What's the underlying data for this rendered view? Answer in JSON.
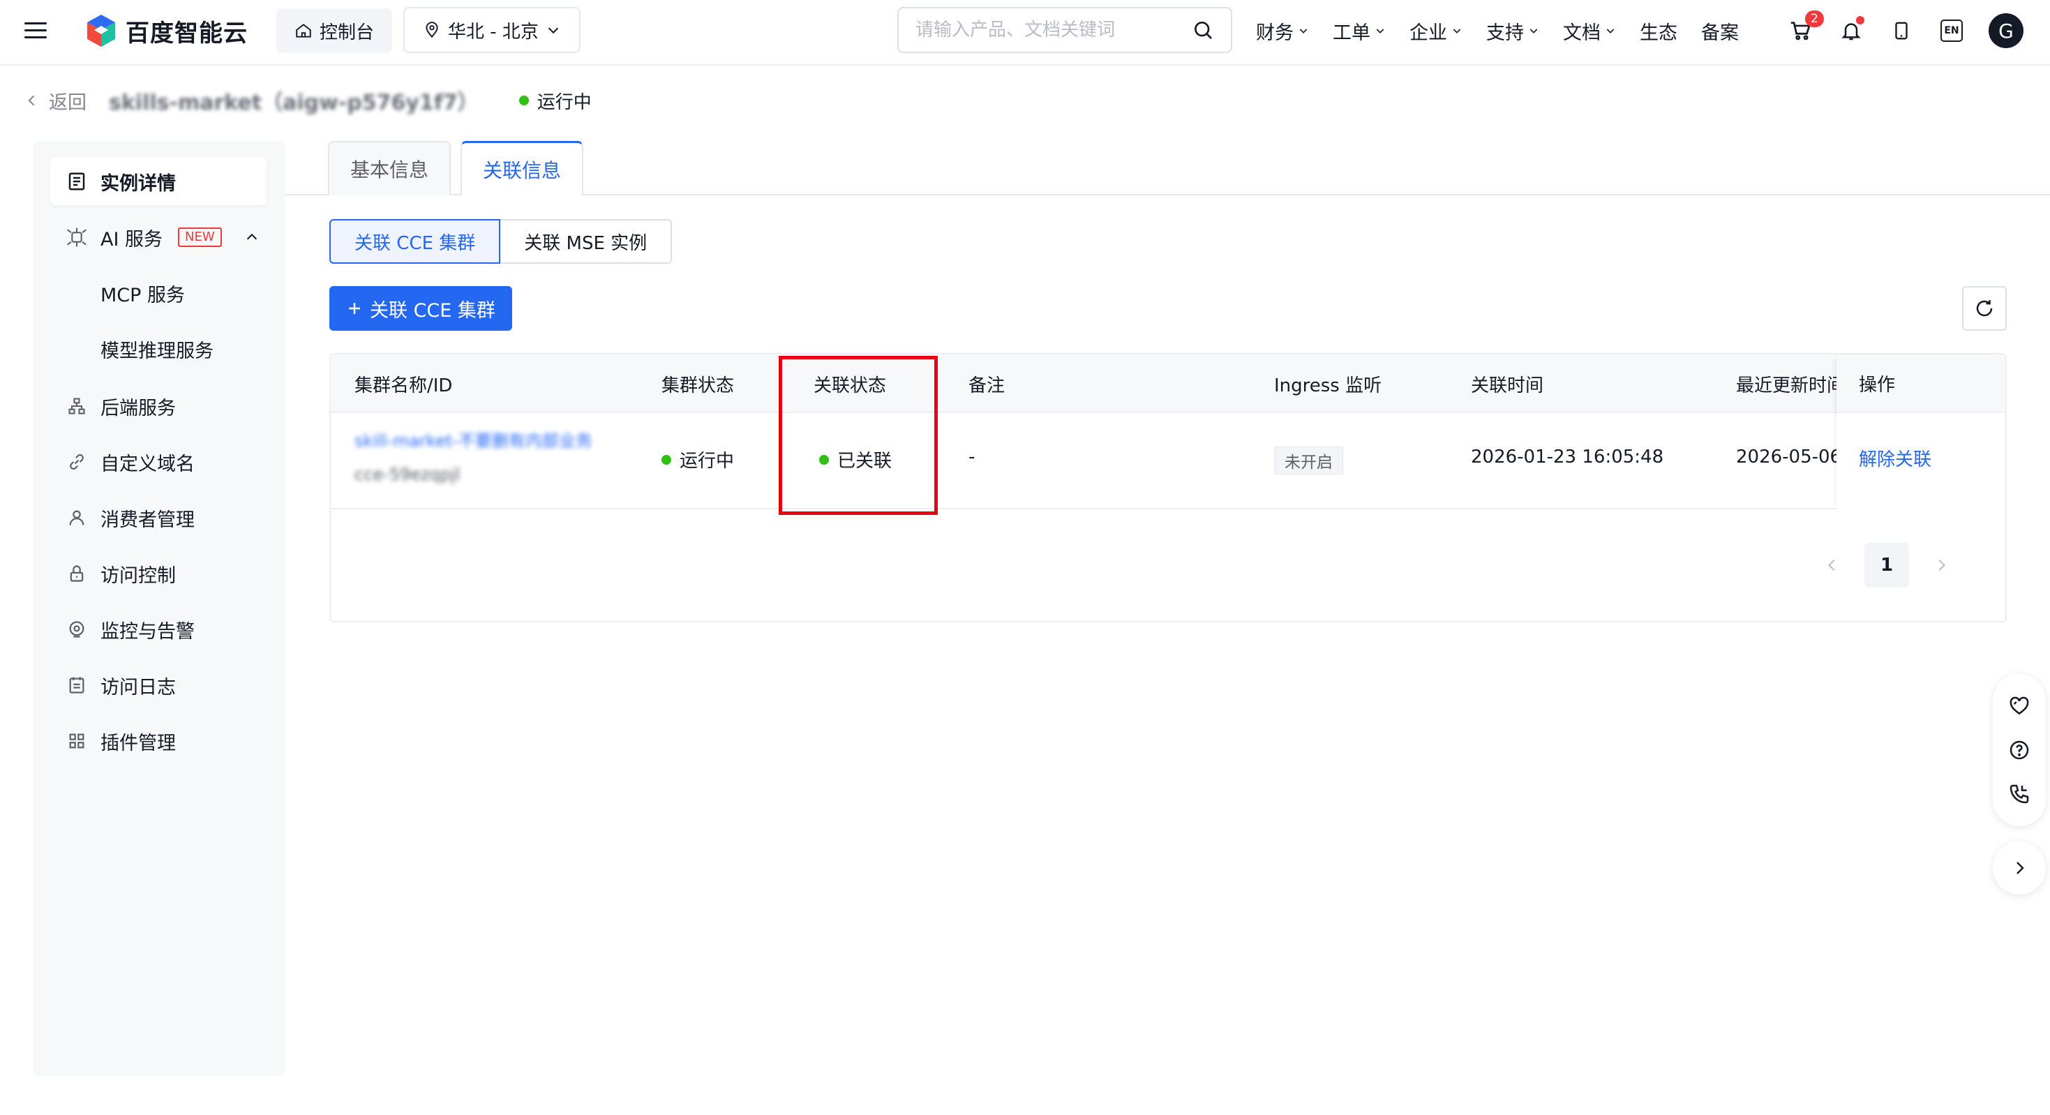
{
  "topbar": {
    "brand": "百度智能云",
    "console": "控制台",
    "region": "华北 - 北京",
    "search_placeholder": "请输入产品、文档关键词",
    "nav": [
      {
        "label": "财务",
        "dropdown": true
      },
      {
        "label": "工单",
        "dropdown": true
      },
      {
        "label": "企业",
        "dropdown": true
      },
      {
        "label": "支持",
        "dropdown": true
      },
      {
        "label": "文档",
        "dropdown": true
      },
      {
        "label": "生态",
        "dropdown": false
      },
      {
        "label": "备案",
        "dropdown": false
      }
    ],
    "cart_count": "2",
    "lang_icon": "EN",
    "avatar_letter": "G"
  },
  "breadcrumb": {
    "back": "返回",
    "instance": "skills-market（aigw-p576y1f7）",
    "status": "运行中"
  },
  "sidebar": {
    "items": [
      {
        "label": "实例详情",
        "icon": "list-detail-icon"
      },
      {
        "label": "AI 服务",
        "icon": "ai-service-icon",
        "badge": "NEW"
      },
      {
        "label": "MCP 服务"
      },
      {
        "label": "模型推理服务"
      },
      {
        "label": "后端服务",
        "icon": "backend-icon"
      },
      {
        "label": "自定义域名",
        "icon": "link-icon"
      },
      {
        "label": "消费者管理",
        "icon": "user-icon"
      },
      {
        "label": "访问控制",
        "icon": "lock-icon"
      },
      {
        "label": "监控与告警",
        "icon": "monitor-icon"
      },
      {
        "label": "访问日志",
        "icon": "log-icon"
      },
      {
        "label": "插件管理",
        "icon": "grid-icon"
      }
    ]
  },
  "tabs": [
    {
      "label": "基本信息",
      "active": false
    },
    {
      "label": "关联信息",
      "active": true
    }
  ],
  "segment": [
    {
      "label": "关联 CCE 集群",
      "active": true
    },
    {
      "label": "关联 MSE 实例",
      "active": false
    }
  ],
  "actions": {
    "add_button": "关联 CCE 集群"
  },
  "table": {
    "columns": [
      "集群名称/ID",
      "集群状态",
      "关联状态",
      "备注",
      "Ingress 监听",
      "关联时间",
      "最近更新时间",
      "操作"
    ],
    "rows": [
      {
        "name": "skill-market-不要删有内部业务",
        "id": "cce-59ezqpjl",
        "cluster_status": "运行中",
        "link_status": "已关联",
        "remark": "-",
        "ingress": "未开启",
        "link_time": "2026-01-23 16:05:48",
        "update_time": "2026-05-06",
        "op": "解除关联"
      }
    ]
  },
  "pager": {
    "current": "1"
  },
  "colors": {
    "primary": "#2468f2",
    "success": "#30bf13",
    "highlight": "#e60012"
  }
}
